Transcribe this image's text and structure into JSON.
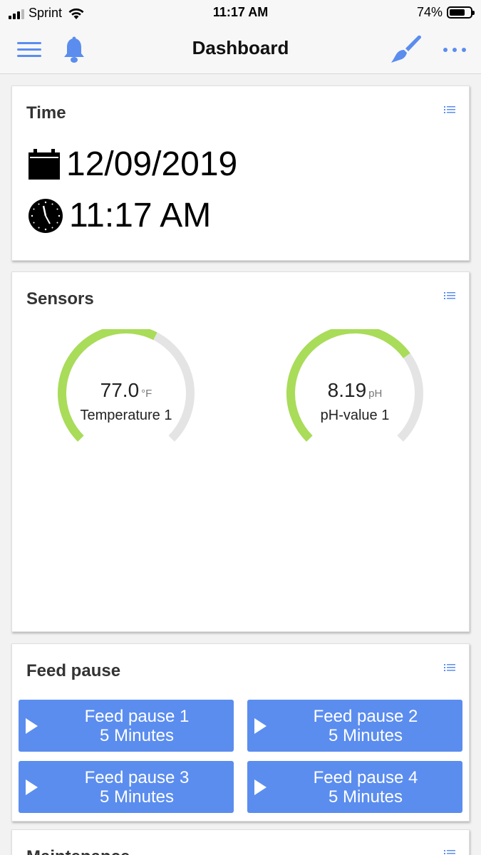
{
  "status_bar": {
    "carrier": "Sprint",
    "time": "11:17 AM",
    "battery": "74%",
    "battery_level": 0.74
  },
  "navbar": {
    "title": "Dashboard"
  },
  "time_card": {
    "title": "Time",
    "date": "12/09/2019",
    "time": "11:17 AM"
  },
  "sensors_card": {
    "title": "Sensors",
    "gauges": [
      {
        "value": "77.0",
        "unit": "°F",
        "label": "Temperature 1",
        "fill_fraction": 0.6
      },
      {
        "value": "8.19",
        "unit": "pH",
        "label": "pH-value 1",
        "fill_fraction": 0.7
      }
    ]
  },
  "feed_card": {
    "title": "Feed pause",
    "buttons": [
      {
        "name": "Feed pause 1",
        "duration": "5 Minutes"
      },
      {
        "name": "Feed pause 2",
        "duration": "5 Minutes"
      },
      {
        "name": "Feed pause 3",
        "duration": "5 Minutes"
      },
      {
        "name": "Feed pause 4",
        "duration": "5 Minutes"
      }
    ]
  },
  "maintenance_card": {
    "title": "Maintenance"
  },
  "colors": {
    "accent": "#5b8def",
    "gauge_fill": "#a9dc59",
    "gauge_track": "#e4e4e4"
  }
}
